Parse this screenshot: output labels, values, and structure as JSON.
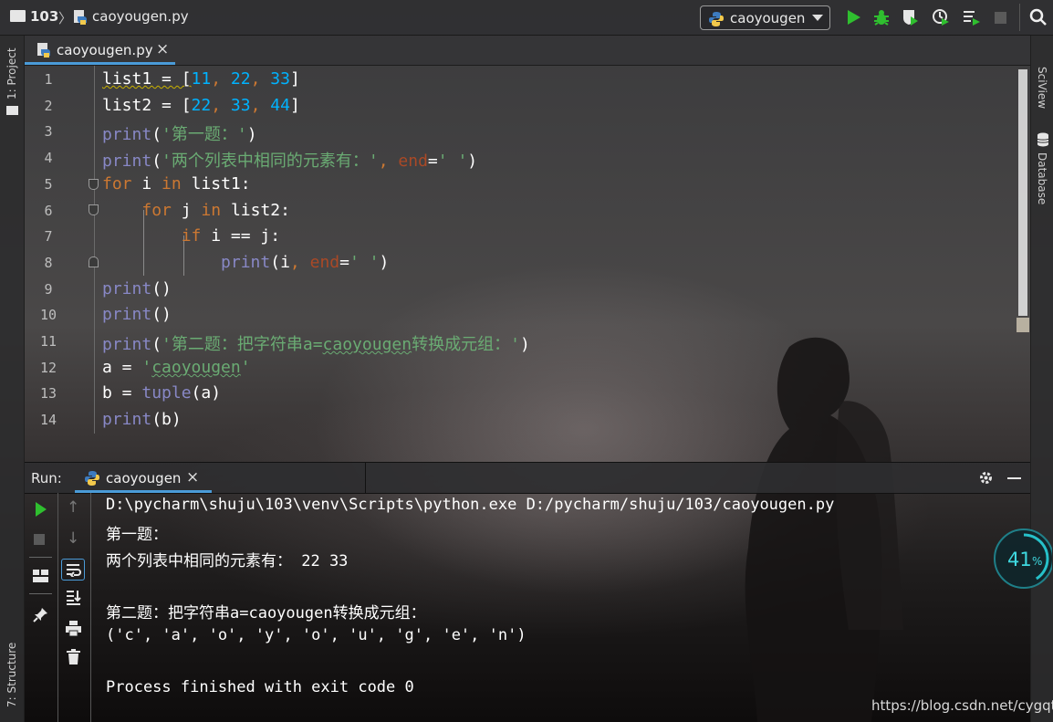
{
  "breadcrumb": {
    "project": "103",
    "file": "caoyougen.py"
  },
  "run_config": {
    "label": "caoyougen"
  },
  "left_strip": {
    "project_label": "1: Project",
    "structure_label": "7: Structure"
  },
  "right_strip": {
    "sciview_label": "SciView",
    "database_label": "Database"
  },
  "editor_tab": {
    "label": "caoyougen.py",
    "close": "×"
  },
  "line_numbers": [
    "1",
    "2",
    "3",
    "4",
    "5",
    "6",
    "7",
    "8",
    "9",
    "10",
    "11",
    "12",
    "13",
    "14"
  ],
  "code": {
    "l1": {
      "a": "list1 = [",
      "n1": "11",
      "c": ",",
      "n2": "22",
      "n3": "33",
      "z": "]"
    },
    "l2": {
      "a": "list2 = [",
      "n1": "22",
      "n2": "33",
      "n3": "44",
      "z": "]"
    },
    "l3": {
      "fn": "print",
      "s": "'第一题：'"
    },
    "l4": {
      "fn": "print",
      "s": "'两个列表中相同的元素有：'",
      "kw": "end",
      "s2": "' '"
    },
    "l5": {
      "kw1": "for",
      "var": "i",
      "kw2": "in",
      "rest": "list1:"
    },
    "l6": {
      "kw1": "for",
      "var": "j",
      "kw2": "in",
      "rest": "list2:"
    },
    "l7": {
      "kw": "if",
      "rest": "i == j:"
    },
    "l8": {
      "fn": "print",
      "a": "(i",
      "kw": "end",
      "s": "' '"
    },
    "l9": {
      "fn": "print",
      "rest": "()"
    },
    "l10": {
      "fn": "print",
      "rest": "()"
    },
    "l11": {
      "fn": "print",
      "s_pre": "'第二题：把字符串a=",
      "s_wavy": "caoyougen",
      "s_post": "转换成元组：'"
    },
    "l12": {
      "a": "a = ",
      "s_q": "'",
      "s_wavy": "caoyougen",
      "s_q2": "'"
    },
    "l13": {
      "a": "b = ",
      "fn": "tuple",
      "rest": "(a)"
    },
    "l14": {
      "fn": "print",
      "rest": "(b)"
    }
  },
  "run_panel": {
    "label": "Run:",
    "tab_label": "caoyougen",
    "close": "×",
    "output": [
      "D:\\pycharm\\shuju\\103\\venv\\Scripts\\python.exe D:/pycharm/shuju/103/caoyougen.py",
      "第一题：",
      "两个列表中相同的元素有： 22 33",
      "第二题：把字符串a=caoyougen转换成元组：",
      "('c', 'a', 'o', 'y', 'o', 'u', 'g', 'e', 'n')",
      "Process finished with exit code 0"
    ]
  },
  "gauge": {
    "value": "41",
    "unit": "%"
  },
  "watermark": "https://blog.csdn.net/cygqtt",
  "colors": {
    "accent": "#4a9bd8",
    "keyword": "#cc7832",
    "string": "#6aab73",
    "number": "#00b3ff",
    "builtin": "#8888c6",
    "run_green": "#2fbf2f"
  }
}
